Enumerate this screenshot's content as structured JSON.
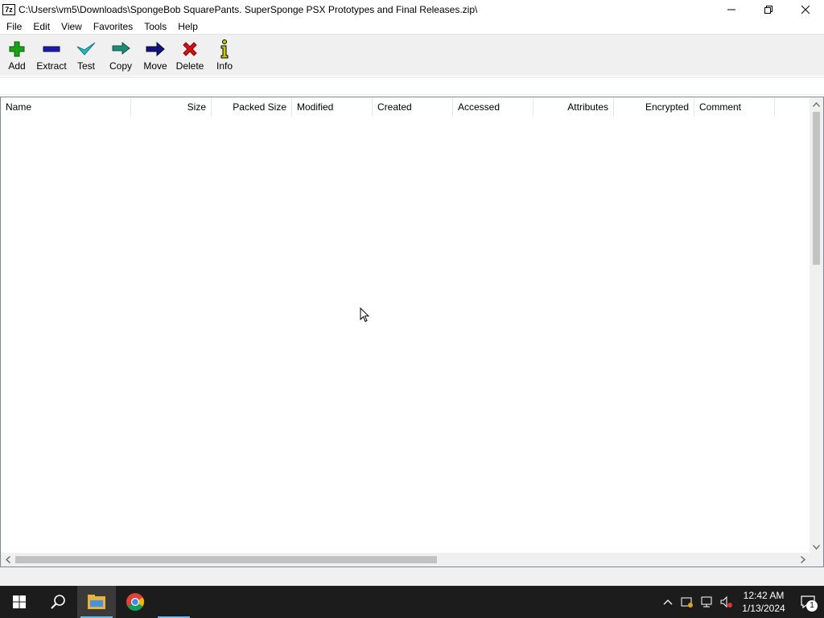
{
  "window": {
    "app_icon_text": "7z",
    "title": "C:\\Users\\vm5\\Downloads\\SpongeBob SquarePants. SuperSponge PSX Prototypes and Final Releases.zip\\",
    "minimize_icon": "minimize-icon",
    "restore_icon": "restore-icon",
    "close_icon": "close-icon"
  },
  "menu": {
    "items": [
      "File",
      "Edit",
      "View",
      "Favorites",
      "Tools",
      "Help"
    ]
  },
  "toolbar": {
    "buttons": [
      {
        "label": "Add",
        "icon": "plus-icon",
        "color": "#1aa11a"
      },
      {
        "label": "Extract",
        "icon": "minus-icon",
        "color": "#1c1ca8"
      },
      {
        "label": "Test",
        "icon": "checkmark-icon",
        "color": "#2bb6c4"
      },
      {
        "label": "Copy",
        "icon": "double-arrow-icon",
        "color": "#1f8c7a"
      },
      {
        "label": "Move",
        "icon": "arrow-right-icon",
        "color": "#141478"
      },
      {
        "label": "Delete",
        "icon": "x-icon",
        "color": "#d41414"
      },
      {
        "label": "Info",
        "icon": "info-icon",
        "color": "#c8c814"
      }
    ]
  },
  "list": {
    "columns": [
      "Name",
      "Size",
      "Packed Size",
      "Modified",
      "Created",
      "Accessed",
      "Attributes",
      "Encrypted",
      "Comment"
    ],
    "rows": []
  },
  "taskbar": {
    "start_icon": "windows-logo-icon",
    "search_icon": "search-icon",
    "apps": [
      {
        "name": "file-explorer-icon",
        "active": true
      },
      {
        "name": "chrome-icon",
        "active": false
      },
      {
        "name": "7zip-window-icon",
        "active": false
      }
    ],
    "tray_icons": [
      "chevron-up-icon",
      "security-icon",
      "network-icon",
      "volume-muted-icon"
    ],
    "time": "12:42 AM",
    "date": "1/13/2024",
    "notification_count": "1"
  },
  "colors": {
    "taskbar_bg": "#1c1c1c",
    "toolbar_bg": "#f0f0f0",
    "accent": "#76b9ed"
  }
}
